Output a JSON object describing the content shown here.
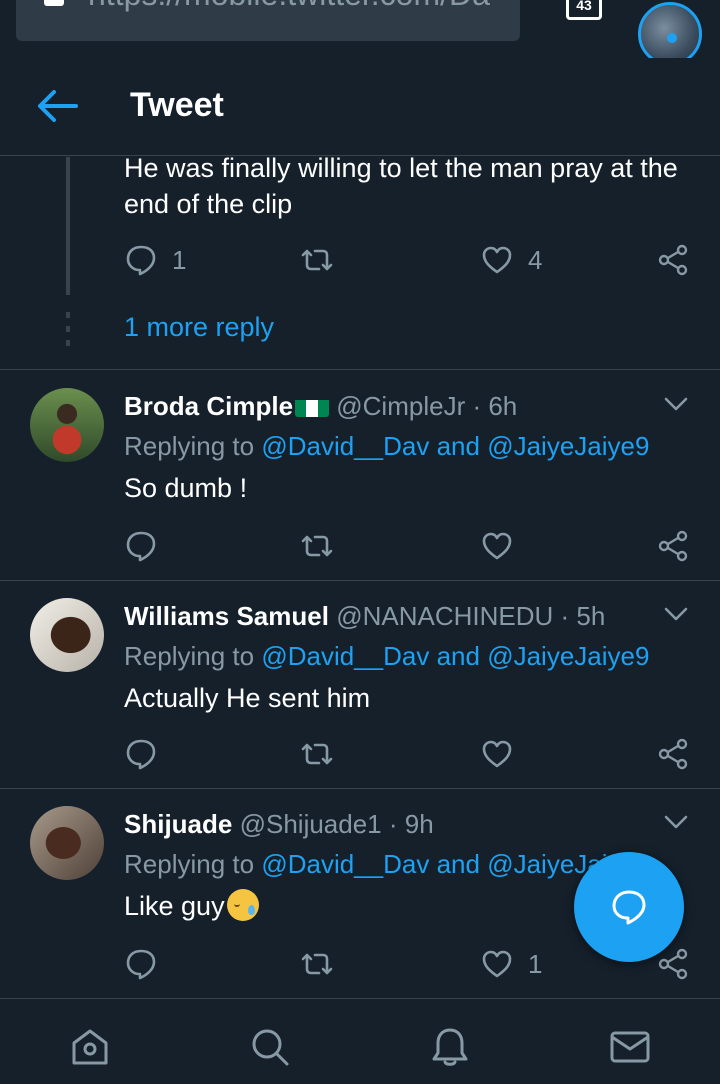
{
  "browser": {
    "url": "https://mobile.twitter.com/Da",
    "tab_count": "43"
  },
  "header": {
    "title": "Tweet"
  },
  "thread_tweet": {
    "text": "He was finally willing to let the man pray at the end of the clip",
    "reply_count": "1",
    "like_count": "4",
    "more_replies_label": "1 more reply"
  },
  "replies": [
    {
      "name": "Broda Cimple",
      "handle": "@CimpleJr",
      "time": "· 6h",
      "replying_prefix": "Replying to",
      "mention1": "@David__Dav",
      "and_word": "and",
      "mention2": "@JaiyeJaiye9",
      "text": "So dumb !",
      "reply_count": "",
      "like_count": ""
    },
    {
      "name": "Williams Samuel",
      "handle": "@NANACHINEDU",
      "time": "· 5h",
      "replying_prefix": "Replying to",
      "mention1": "@David__Dav",
      "and_word": "and",
      "mention2": "@JaiyeJaiye9",
      "text": "Actually He sent him",
      "reply_count": "",
      "like_count": ""
    },
    {
      "name": "Shijuade",
      "handle": "@Shijuade1",
      "time": "· 9h",
      "replying_prefix": "Replying to",
      "mention1": "@David__Dav",
      "and_word": "and",
      "mention2": "@JaiyeJaiye9",
      "text": "Like guy",
      "reply_count": "",
      "like_count": "1"
    }
  ],
  "colors": {
    "background": "#15202b",
    "accent": "#1da1f2",
    "secondary_text": "#8899a6",
    "divider": "#38444d",
    "flag_green": "#008751"
  },
  "icons": {
    "back": "arrow-left-icon",
    "reply": "speech-bubble-icon",
    "retweet": "retweet-icon",
    "like": "heart-icon",
    "share": "share-icon",
    "more": "chevron-down-icon",
    "compose": "compose-reply-icon",
    "nav": [
      "home-icon",
      "search-icon",
      "bell-icon",
      "envelope-icon"
    ]
  }
}
